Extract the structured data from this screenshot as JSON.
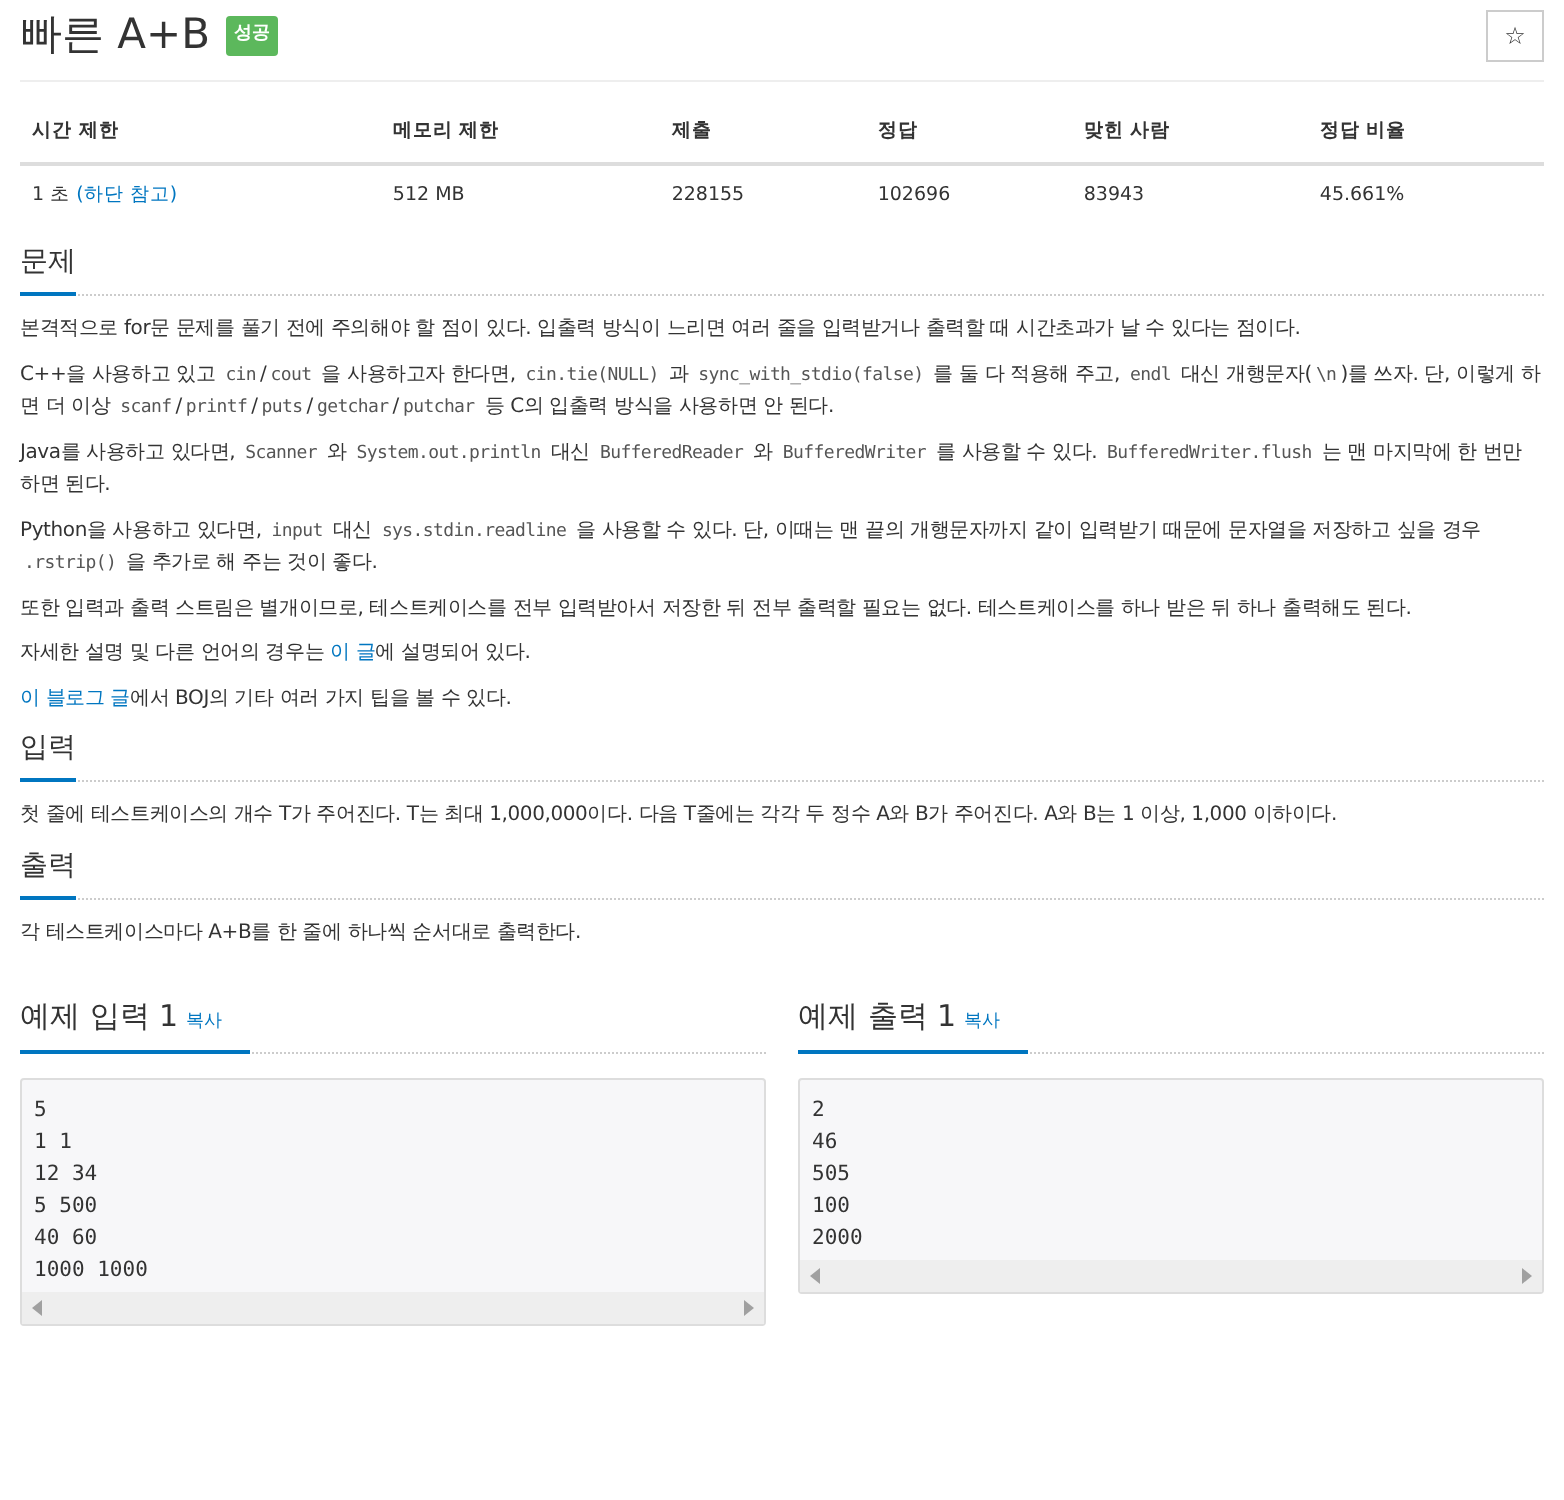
{
  "title": "빠른 A+B",
  "result_badge": "성공",
  "star_button": "☆",
  "stats": {
    "columns": [
      "시간 제한",
      "메모리 제한",
      "제출",
      "정답",
      "맞힌 사람",
      "정답 비율"
    ],
    "values": [
      {
        "text": "1 초 ",
        "link": "(하단 참고)"
      },
      {
        "text": "512 MB"
      },
      {
        "text": "228155"
      },
      {
        "text": "102696"
      },
      {
        "text": "83943"
      },
      {
        "text": "45.661%"
      }
    ]
  },
  "sections": [
    {
      "heading": "문제",
      "paragraphs": [
        [
          {
            "kind": "text",
            "text": "본격적으로 for문 문제를 풀기 전에 주의해야 할 점이 있다. 입출력 방식이 느리면 여러 줄을 입력받거나 출력할 때 시간초과가 날 수 있다는 점이다."
          }
        ],
        [
          {
            "kind": "text",
            "text": "C++을 사용하고 있고 "
          },
          {
            "kind": "code",
            "text": "cin"
          },
          {
            "kind": "text",
            "text": "/"
          },
          {
            "kind": "code",
            "text": "cout"
          },
          {
            "kind": "text",
            "text": " 을 사용하고자 한다면, "
          },
          {
            "kind": "code",
            "text": "cin.tie(NULL)"
          },
          {
            "kind": "text",
            "text": " 과 "
          },
          {
            "kind": "code",
            "text": "sync_with_stdio(false)"
          },
          {
            "kind": "text",
            "text": " 를 둘 다 적용해 주고, "
          },
          {
            "kind": "code",
            "text": "endl"
          },
          {
            "kind": "text",
            "text": " 대신 개행문자("
          },
          {
            "kind": "code",
            "text": "\\n"
          },
          {
            "kind": "text",
            "text": ")를 쓰자. 단, 이렇게 하면 더 이상 "
          },
          {
            "kind": "code",
            "text": "scanf"
          },
          {
            "kind": "text",
            "text": "/"
          },
          {
            "kind": "code",
            "text": "printf"
          },
          {
            "kind": "text",
            "text": "/"
          },
          {
            "kind": "code",
            "text": "puts"
          },
          {
            "kind": "text",
            "text": "/"
          },
          {
            "kind": "code",
            "text": "getchar"
          },
          {
            "kind": "text",
            "text": "/"
          },
          {
            "kind": "code",
            "text": "putchar"
          },
          {
            "kind": "text",
            "text": " 등 C의 입출력 방식을 사용하면 안 된다."
          }
        ],
        [
          {
            "kind": "text",
            "text": "Java를 사용하고 있다면, "
          },
          {
            "kind": "code",
            "text": "Scanner"
          },
          {
            "kind": "text",
            "text": " 와 "
          },
          {
            "kind": "code",
            "text": "System.out.println"
          },
          {
            "kind": "text",
            "text": " 대신 "
          },
          {
            "kind": "code",
            "text": "BufferedReader"
          },
          {
            "kind": "text",
            "text": " 와 "
          },
          {
            "kind": "code",
            "text": "BufferedWriter"
          },
          {
            "kind": "text",
            "text": " 를 사용할 수 있다. "
          },
          {
            "kind": "code",
            "text": "BufferedWriter.flush"
          },
          {
            "kind": "text",
            "text": " 는 맨 마지막에 한 번만 하면 된다."
          }
        ],
        [
          {
            "kind": "text",
            "text": "Python을 사용하고 있다면, "
          },
          {
            "kind": "code",
            "text": "input"
          },
          {
            "kind": "text",
            "text": " 대신 "
          },
          {
            "kind": "code",
            "text": "sys.stdin.readline"
          },
          {
            "kind": "text",
            "text": " 을 사용할 수 있다. 단, 이때는 맨 끝의 개행문자까지 같이 입력받기 때문에 문자열을 저장하고 싶을 경우 "
          },
          {
            "kind": "code",
            "text": ".rstrip()"
          },
          {
            "kind": "text",
            "text": " 을 추가로 해 주는 것이 좋다."
          }
        ],
        [
          {
            "kind": "text",
            "text": "또한 입력과 출력 스트림은 별개이므로, 테스트케이스를 전부 입력받아서 저장한 뒤 전부 출력할 필요는 없다. 테스트케이스를 하나 받은 뒤 하나 출력해도 된다."
          }
        ],
        [
          {
            "kind": "text",
            "text": "자세한 설명 및 다른 언어의 경우는 "
          },
          {
            "kind": "link",
            "text": "이 글"
          },
          {
            "kind": "text",
            "text": "에 설명되어 있다."
          }
        ],
        [
          {
            "kind": "link",
            "text": "이 블로그 글"
          },
          {
            "kind": "text",
            "text": "에서 BOJ의 기타 여러 가지 팁을 볼 수 있다."
          }
        ]
      ]
    },
    {
      "heading": "입력",
      "paragraphs": [
        [
          {
            "kind": "text",
            "text": "첫 줄에 테스트케이스의 개수 T가 주어진다. T는 최대 1,000,000이다. 다음 T줄에는 각각 두 정수 A와 B가 주어진다. A와 B는 1 이상, 1,000 이하이다."
          }
        ]
      ]
    },
    {
      "heading": "출력",
      "paragraphs": [
        [
          {
            "kind": "text",
            "text": "각 테스트케이스마다 A+B를 한 줄에 하나씩 순서대로 출력한다."
          }
        ]
      ]
    }
  ],
  "samples": [
    {
      "heading": "예제 입력 1",
      "copy": "복사",
      "lines": [
        "5",
        "1 1",
        "12 34",
        "5 500",
        "40 60",
        "1000 1000"
      ]
    },
    {
      "heading": "예제 출력 1",
      "copy": "복사",
      "lines": [
        "2",
        "46",
        "505",
        "100",
        "2000"
      ]
    }
  ]
}
